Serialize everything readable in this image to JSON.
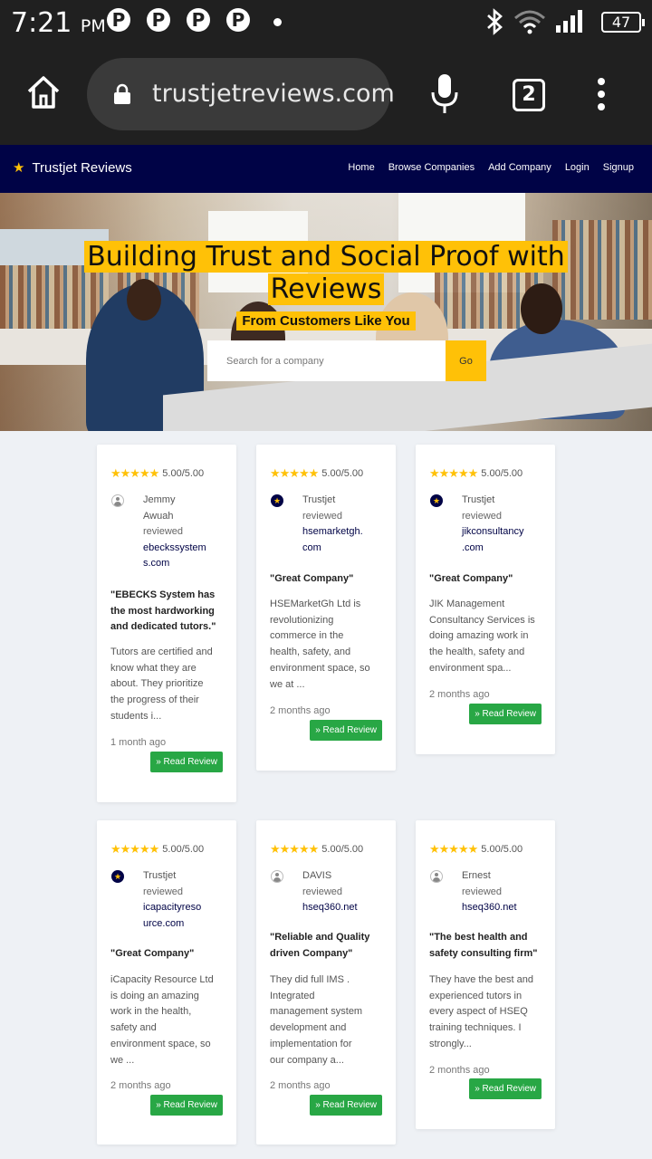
{
  "status_bar": {
    "time": "7:21",
    "ampm": "PM",
    "notification_icons": [
      "P",
      "P",
      "P",
      "P"
    ],
    "battery": "47"
  },
  "browser": {
    "url": "trustjetreviews.com",
    "tab_count": "2"
  },
  "nav": {
    "brand": "Trustjet Reviews",
    "links": [
      "Home",
      "Browse Companies",
      "Add Company",
      "Login",
      "Signup"
    ]
  },
  "hero": {
    "title_line1": "Building Trust and Social Proof with",
    "title_line2": "Reviews",
    "subtitle": "From Customers Like You",
    "search_placeholder": "Search for a company",
    "search_button": "Go"
  },
  "colors": {
    "accent": "#ffc107",
    "navy": "#000346",
    "button_green": "#28a745"
  },
  "cards": [
    {
      "rating": "5.00/5.00",
      "avatar": "user-icon",
      "name_lines": [
        "Jemmy",
        "Awuah"
      ],
      "reviewed": "reviewed",
      "domain_lines": [
        "ebeckssystem",
        "s.com"
      ],
      "title_lines": [
        "\"EBECKS System has",
        "the most hardworking",
        "and dedicated tutors.\""
      ],
      "body_lines": [
        "Tutors are certified and",
        "know what they are",
        "about. They prioritize",
        "the progress of their",
        "students i..."
      ],
      "ago": "1 month ago",
      "button": "» Read Review"
    },
    {
      "rating": "5.00/5.00",
      "avatar": "star-icon",
      "name_lines": [
        "Trustjet"
      ],
      "reviewed": "reviewed",
      "domain_lines": [
        "hsemarketgh.",
        "com"
      ],
      "title_lines": [
        "\"Great Company\""
      ],
      "body_lines": [
        "HSEMarketGh Ltd is",
        "revolutionizing",
        "commerce in the",
        "health, safety, and",
        "environment space, so",
        "we at ..."
      ],
      "ago": "2 months ago",
      "button": "» Read Review"
    },
    {
      "rating": "5.00/5.00",
      "avatar": "star-icon",
      "name_lines": [
        "Trustjet"
      ],
      "reviewed": "reviewed",
      "domain_lines": [
        "jikconsultancy",
        ".com"
      ],
      "title_lines": [
        "\"Great Company\""
      ],
      "body_lines": [
        "JIK Management",
        "Consultancy Services is",
        "doing amazing work in",
        "the health, safety and",
        "environment spa..."
      ],
      "ago": "2 months ago",
      "button": "» Read Review"
    },
    {
      "rating": "5.00/5.00",
      "avatar": "star-icon",
      "name_lines": [
        "Trustjet"
      ],
      "reviewed": "reviewed",
      "domain_lines": [
        "icapacityreso",
        "urce.com"
      ],
      "title_lines": [
        "\"Great Company\""
      ],
      "body_lines": [
        "iCapacity Resource Ltd",
        "is doing an amazing",
        "work in the health,",
        "safety and",
        "environment space, so",
        "we ..."
      ],
      "ago": "2 months ago",
      "button": "» Read Review"
    },
    {
      "rating": "5.00/5.00",
      "avatar": "user-icon",
      "name_lines": [
        "DAVIS"
      ],
      "reviewed": "reviewed",
      "domain_lines": [
        "hseq360.net"
      ],
      "title_lines": [
        "\"Reliable and Quality",
        "driven Company\""
      ],
      "body_lines": [
        "They did full IMS .",
        "Integrated",
        "management system",
        "development and",
        "implementation for",
        "our company a..."
      ],
      "ago": "2 months ago",
      "button": "» Read Review"
    },
    {
      "rating": "5.00/5.00",
      "avatar": "user-icon",
      "name_lines": [
        "Ernest"
      ],
      "reviewed": "reviewed",
      "domain_lines": [
        "hseq360.net"
      ],
      "title_lines": [
        "\"The best health and",
        "safety consulting firm\""
      ],
      "body_lines": [
        "They have the best and",
        "experienced tutors in",
        "every aspect of HSEQ",
        "training techniques. I",
        "strongly..."
      ],
      "ago": "2 months ago",
      "button": "» Read Review"
    }
  ]
}
